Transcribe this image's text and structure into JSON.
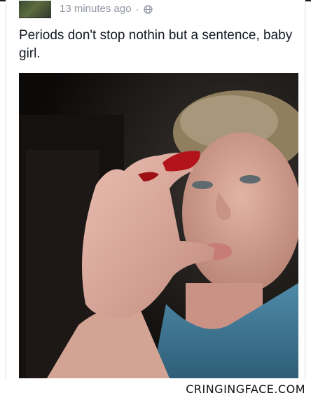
{
  "post": {
    "timestamp": "13 minutes ago",
    "separator": "·",
    "privacy_icon": "globe-icon",
    "text": "Periods don't stop nothin but a sentence, baby girl."
  },
  "photo": {
    "subject": "selfie-photo"
  },
  "watermark": {
    "text": "CRINGINGFACE.COM"
  },
  "colors": {
    "timestamp": "#9197a3",
    "post_text": "#141823",
    "card_border": "#d9d9d9"
  }
}
